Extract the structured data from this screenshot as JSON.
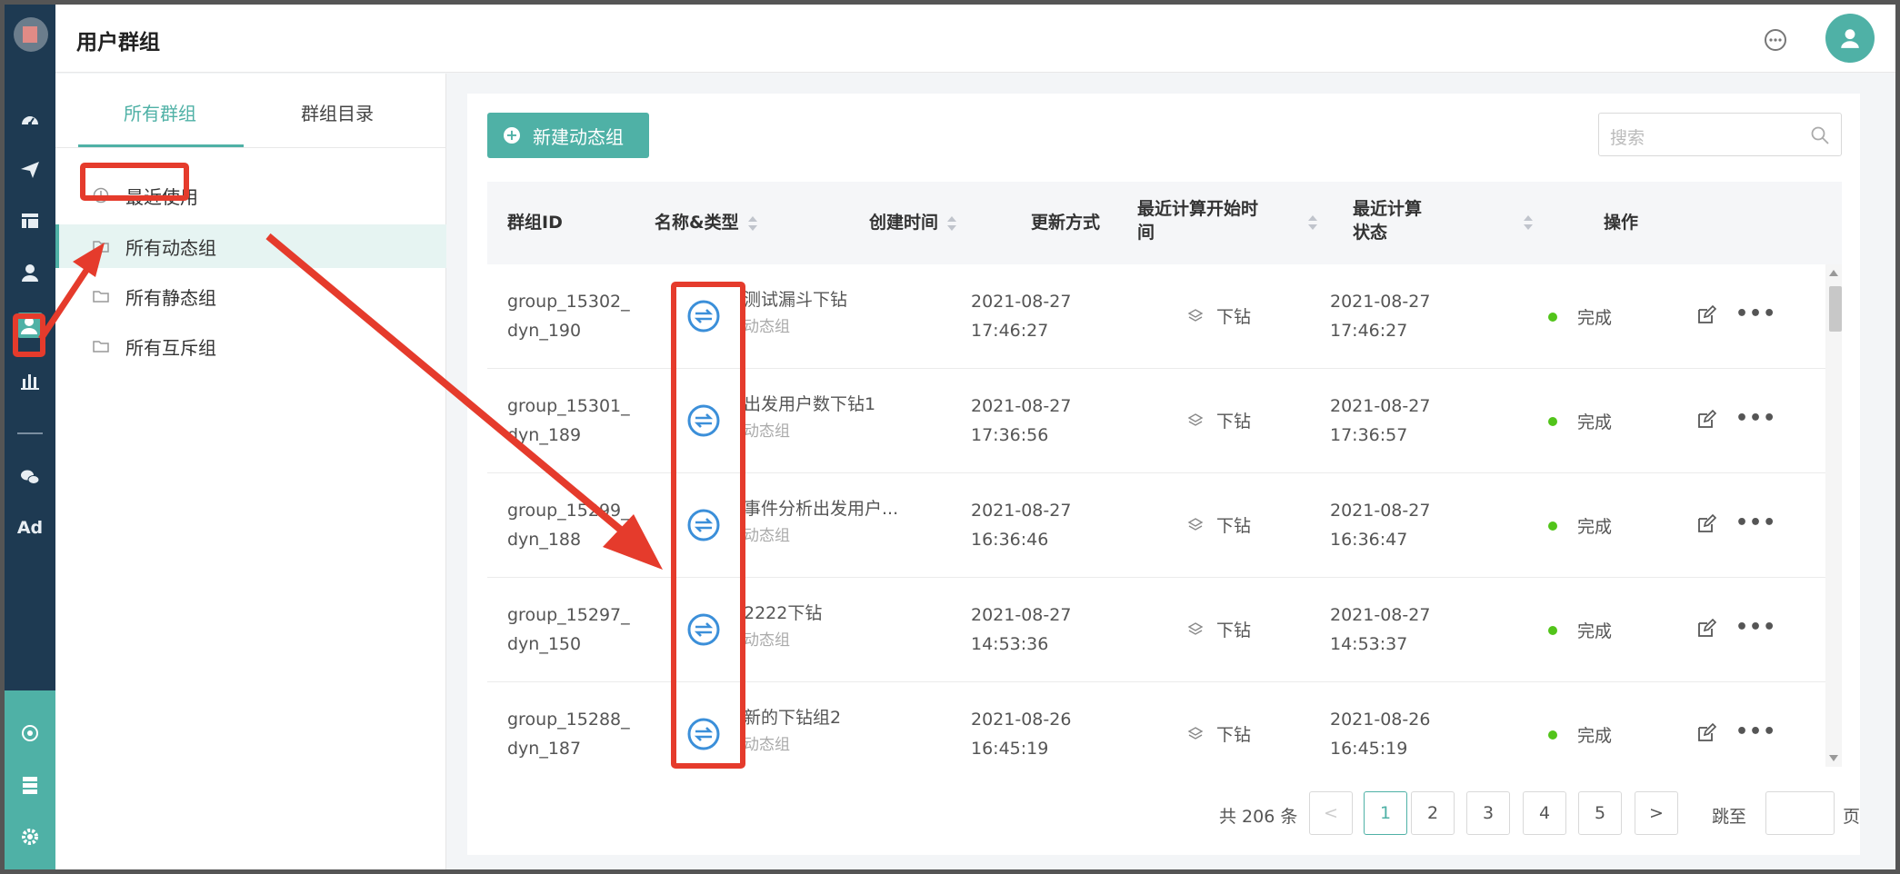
{
  "header": {
    "title": "用户群组"
  },
  "rail": {
    "ad_label": "Ad",
    "icons": [
      "dashboard-icon",
      "send-icon",
      "layout-icon",
      "user-icon",
      "user-group-icon",
      "bar-chart-icon",
      "wechat-icon",
      "target-icon",
      "server-icon",
      "settings-icon"
    ]
  },
  "sidepanel": {
    "tabs": [
      {
        "label": "所有群组",
        "active": true
      },
      {
        "label": "群组目录",
        "active": false
      }
    ],
    "items": [
      {
        "label": "最近使用",
        "icon": "clock-icon"
      },
      {
        "label": "所有动态组",
        "icon": "folder-icon",
        "active": true
      },
      {
        "label": "所有静态组",
        "icon": "folder-icon"
      },
      {
        "label": "所有互斥组",
        "icon": "folder-icon"
      }
    ]
  },
  "toolbar": {
    "new_label": "新建动态组",
    "search_placeholder": "搜索"
  },
  "table": {
    "headers": {
      "id": "群组ID",
      "name": "名称&类型",
      "created": "创建时间",
      "update": "更新方式",
      "calc_start_1": "最近计算开始时",
      "calc_start_2": "间",
      "calc_state_1": "最近计算",
      "calc_state_2": "状态",
      "action": "操作"
    },
    "rows": [
      {
        "id1": "group_15302_",
        "id2": "dyn_190",
        "name": "测试漏斗下钻",
        "type": "动态组",
        "created1": "2021-08-27",
        "created2": "17:46:27",
        "update": "下钻",
        "calc1": "2021-08-27",
        "calc2": "17:46:27",
        "status": "完成"
      },
      {
        "id1": "group_15301_",
        "id2": "dyn_189",
        "name": "出发用户数下钻1",
        "type": "动态组",
        "created1": "2021-08-27",
        "created2": "17:36:56",
        "update": "下钻",
        "calc1": "2021-08-27",
        "calc2": "17:36:57",
        "status": "完成"
      },
      {
        "id1": "group_15299_",
        "id2": "dyn_188",
        "name": "事件分析出发用户...",
        "type": "动态组",
        "created1": "2021-08-27",
        "created2": "16:36:46",
        "update": "下钻",
        "calc1": "2021-08-27",
        "calc2": "16:36:47",
        "status": "完成"
      },
      {
        "id1": "group_15297_",
        "id2": "dyn_150",
        "name": "2222下钻",
        "type": "动态组",
        "created1": "2021-08-27",
        "created2": "14:53:36",
        "update": "下钻",
        "calc1": "2021-08-27",
        "calc2": "14:53:37",
        "status": "完成"
      },
      {
        "id1": "group_15288_",
        "id2": "dyn_187",
        "name": "新的下钻组2",
        "type": "动态组",
        "created1": "2021-08-26",
        "created2": "16:45:19",
        "update": "下钻",
        "calc1": "2021-08-26",
        "calc2": "16:45:19",
        "status": "完成"
      }
    ]
  },
  "pagination": {
    "total": "共 206 条",
    "pages": [
      "1",
      "2",
      "3",
      "4",
      "5"
    ],
    "current": "1",
    "prev": "<",
    "next": ">",
    "jump_label": "跳至",
    "page_unit": "页"
  },
  "colors": {
    "accent": "#4fb1a6",
    "rail": "#1e3a52",
    "annotation": "#e53b2c",
    "link_icon": "#3b8fd9"
  }
}
